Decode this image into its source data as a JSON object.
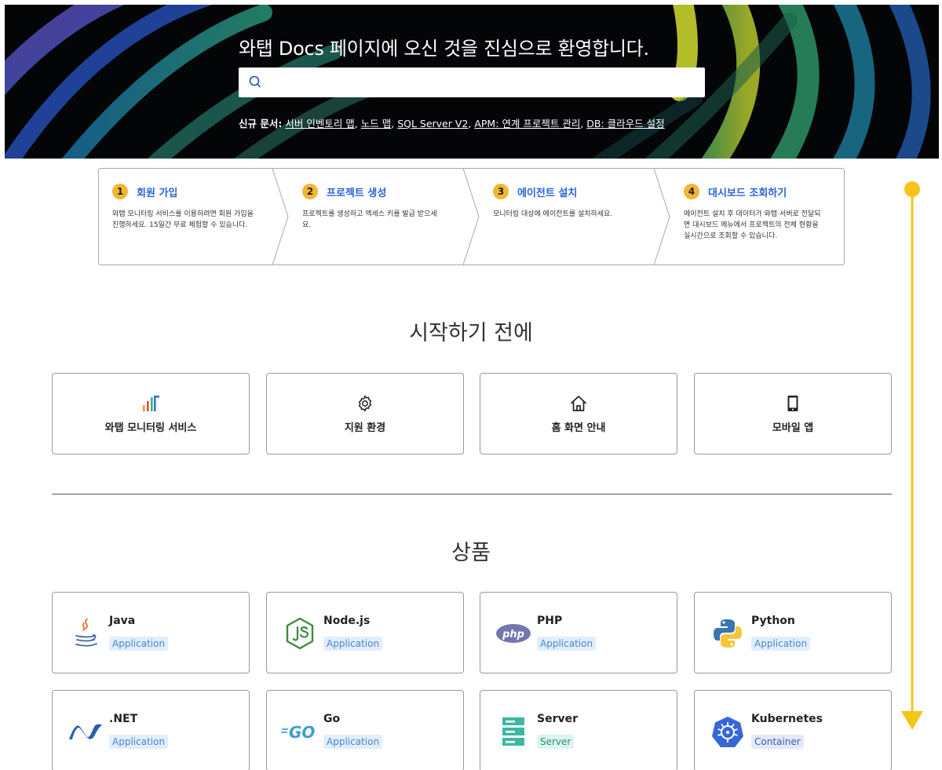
{
  "hero": {
    "title": "와탭 Docs 페이지에 오신 것을 진심으로 환영합니다.",
    "search_placeholder": "",
    "new_docs_label": "신규 문서:",
    "new_docs_links": [
      "서버 인벤토리 맵",
      "노드 맵",
      "SQL Server V2",
      "APM: 연계 프로젝트 관리",
      "DB: 클라우드 설정"
    ],
    "icon": "search-icon"
  },
  "steps": [
    {
      "num": "1",
      "title": "회원 가입",
      "desc": "와탭 모니터링 서비스를 이용하려면 회원 가입을 진행하세요. 15일간 무료 체험할 수 있습니다."
    },
    {
      "num": "2",
      "title": "프로젝트 생성",
      "desc": "프로젝트를 생성하고 액세스 키를 발급 받으세요."
    },
    {
      "num": "3",
      "title": "에이전트 설치",
      "desc": "모니터링 대상에 에이전트를 설치하세요."
    },
    {
      "num": "4",
      "title": "대시보드 조회하기",
      "desc": "에이전트 설치 후 데이터가 와탭 서버로 전달되면 대시보드 메뉴에서 프로젝트의 전체 현황을 실시간으로 조회할 수 있습니다."
    }
  ],
  "intro": {
    "title": "시작하기 전에",
    "cards": [
      {
        "label": "와탭 모니터링 서비스",
        "icon": "whatap-bars-icon"
      },
      {
        "label": "지원 환경",
        "icon": "gear-icon"
      },
      {
        "label": "홈 화면 안내",
        "icon": "home-icon"
      },
      {
        "label": "모바일 앱",
        "icon": "mobile-icon"
      }
    ]
  },
  "products": {
    "title": "상품",
    "items": [
      {
        "name": "Java",
        "tag": "Application",
        "icon": "java-icon"
      },
      {
        "name": "Node.js",
        "tag": "Application",
        "icon": "nodejs-icon"
      },
      {
        "name": "PHP",
        "tag": "Application",
        "icon": "php-icon"
      },
      {
        "name": "Python",
        "tag": "Application",
        "icon": "python-icon"
      },
      {
        "name": ".NET",
        "tag": "Application",
        "icon": "dotnet-icon"
      },
      {
        "name": "Go",
        "tag": "Application",
        "icon": "go-icon"
      },
      {
        "name": "Server",
        "tag": "Server",
        "icon": "server-icon"
      },
      {
        "name": "Kubernetes",
        "tag": "Container",
        "icon": "kubernetes-icon"
      }
    ]
  },
  "colors": {
    "accent": "#f2b632",
    "link": "#2a63d9",
    "scroll_indicator": "#f5c518"
  }
}
